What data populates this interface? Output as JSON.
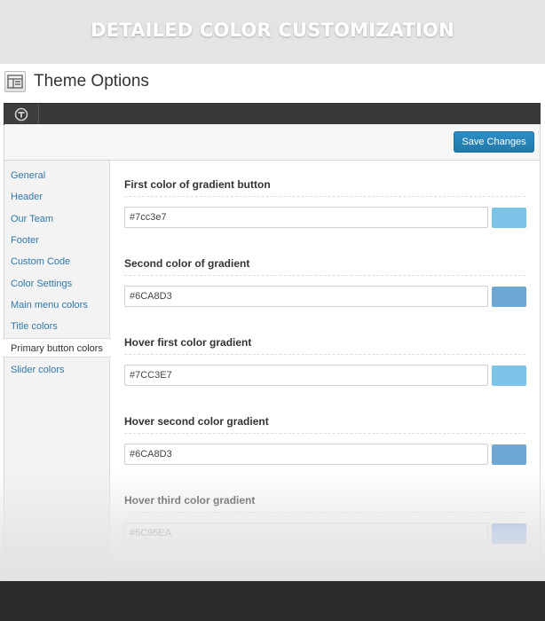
{
  "banner": {
    "title": "DETAILED COLOR CUSTOMIZATION"
  },
  "page": {
    "title": "Theme Options"
  },
  "toolbar": {
    "save_label": "Save Changes"
  },
  "sidebar": {
    "items": [
      {
        "label": "General"
      },
      {
        "label": "Header"
      },
      {
        "label": "Our Team"
      },
      {
        "label": "Footer"
      },
      {
        "label": "Custom Code"
      },
      {
        "label": "Color Settings"
      },
      {
        "label": "Main menu colors"
      },
      {
        "label": "Title colors"
      },
      {
        "label": "Primary button colors",
        "active": true
      },
      {
        "label": "Slider colors"
      }
    ]
  },
  "fields": [
    {
      "label": "First color of gradient button",
      "value": "#7cc3e7",
      "swatch": "#7cc3e7"
    },
    {
      "label": "Second color of gradient",
      "value": "#6CA8D3",
      "swatch": "#6ca8d3"
    },
    {
      "label": "Hover first color gradient",
      "value": "#7CC3E7",
      "swatch": "#7cc3e7"
    },
    {
      "label": "Hover second color gradient",
      "value": "#6CA8D3",
      "swatch": "#6ca8d3"
    },
    {
      "label": "Hover third color gradient",
      "value": "#5C95EA",
      "swatch": "#5c95ea"
    }
  ],
  "colors": {
    "accent": "#2279ab",
    "link": "#2e78a8",
    "header_bar": "#393939",
    "footer_bar": "#2b2b2b"
  }
}
